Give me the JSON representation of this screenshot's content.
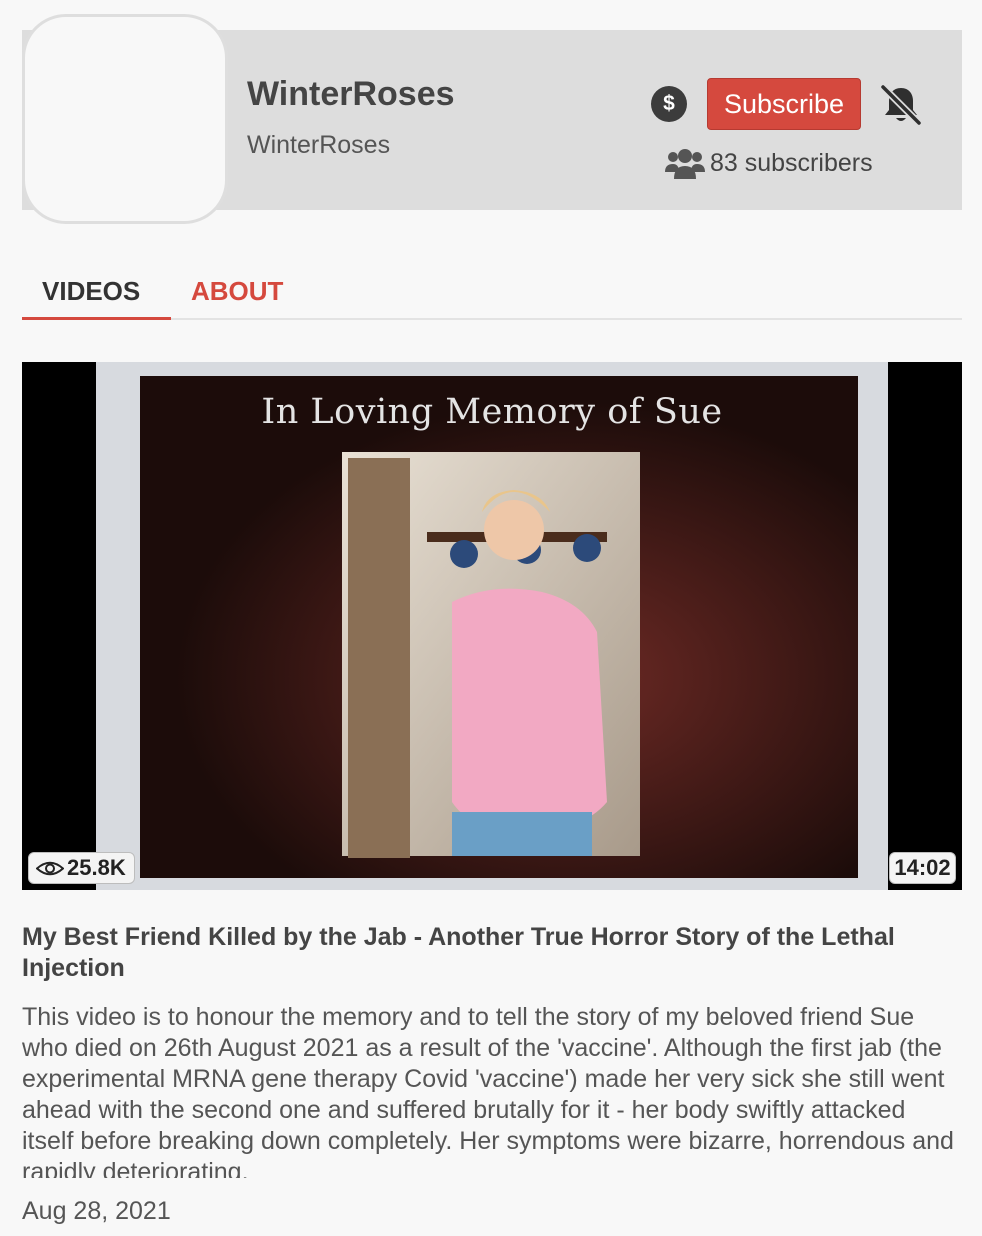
{
  "channel": {
    "name": "WinterRoses",
    "handle": "WinterRoses",
    "tip_icon": "dollar-sign-icon",
    "tip_symbol": "$",
    "subscribe_label": "Subscribe",
    "notification_icon": "bell-slash-icon",
    "subscribers_icon": "users-icon",
    "subscribers_label": "83 subscribers"
  },
  "tabs": [
    {
      "label": "VIDEOS",
      "active": true
    },
    {
      "label": "ABOUT",
      "active": false
    }
  ],
  "video": {
    "thumbnail_text": "In Loving Memory of Sue",
    "views": "25.8K",
    "views_icon": "eye-icon",
    "duration": "14:02",
    "title": "My Best Friend Killed by the Jab - Another True Horror Story of the Lethal Injection",
    "description": "This video is to honour the memory and to tell the story of my beloved friend Sue who died on 26th August 2021 as a result of the 'vaccine'. Although the first jab (the experimental MRNA gene therapy Covid 'vaccine') made her very sick she still went ahead with the second one and suffered brutally for it - her body swiftly attacked itself before breaking down completely. Her symptoms were bizarre, horrendous and rapidly deteriorating.",
    "date": "Aug 28, 2021"
  },
  "colors": {
    "accent": "#d5493e",
    "header_bg": "#dddddd",
    "page_bg": "#f8f8f8"
  }
}
